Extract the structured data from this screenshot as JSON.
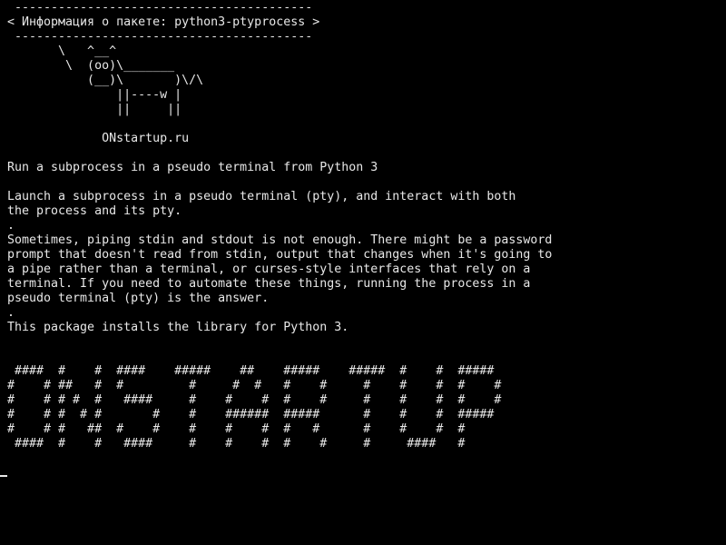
{
  "terminal": {
    "lines": [
      " -----------------------------------------",
      "< Информация о пакете: python3-ptyprocess >",
      " -----------------------------------------",
      "       \\   ^__^",
      "        \\  (oo)\\_______",
      "           (__)\\       )\\/\\",
      "               ||----w |",
      "               ||     ||",
      "",
      "             ONstartup.ru",
      "",
      "Run a subprocess in a pseudo terminal from Python 3",
      "",
      "Launch a subprocess in a pseudo terminal (pty), and interact with both",
      "the process and its pty.",
      ".",
      "Sometimes, piping stdin and stdout is not enough. There might be a password",
      "prompt that doesn't read from stdin, output that changes when it's going to",
      "a pipe rather than a terminal, or curses-style interfaces that rely on a",
      "terminal. If you need to automate these things, running the process in a",
      "pseudo terminal (pty) is the answer.",
      ".",
      "This package installs the library for Python 3.",
      "",
      "",
      " ####  #    #  ####    #####    ##    #####    #####  #    #  #####",
      "#    # ##   #  #         #     #  #   #    #     #    #    #  #    #",
      "#    # # #  #   ####     #    #    #  #    #     #    #    #  #    #",
      "#    # #  # #       #    #    ######  #####      #    #    #  #####",
      "#    # #   ##  #    #    #    #    #  #   #      #    #    #  #",
      " ####  #    #   ####     #    #    #  #    #     #     ####   #"
    ]
  }
}
